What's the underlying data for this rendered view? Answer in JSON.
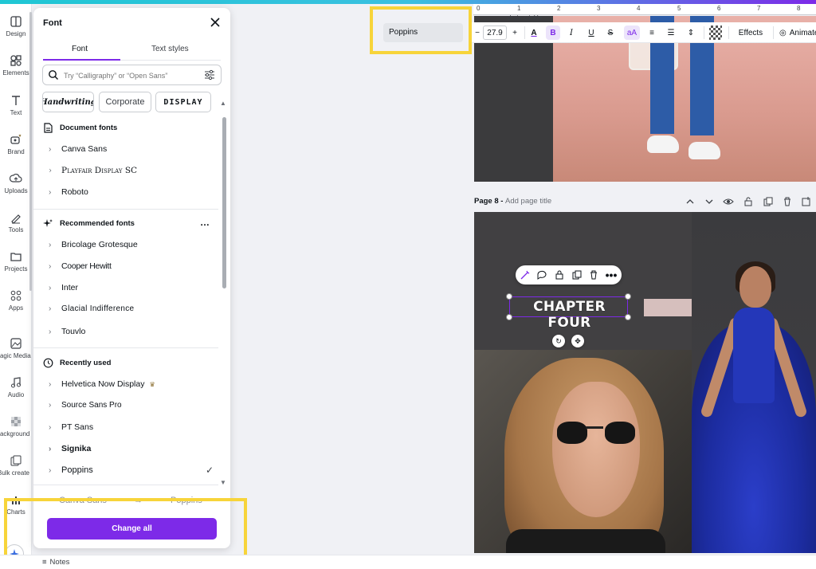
{
  "rail": {
    "items": [
      {
        "label": "Design",
        "icon": "design-icon"
      },
      {
        "label": "Elements",
        "icon": "elements-icon"
      },
      {
        "label": "Text",
        "icon": "text-icon"
      },
      {
        "label": "Brand",
        "icon": "brand-icon"
      },
      {
        "label": "Uploads",
        "icon": "uploads-icon"
      },
      {
        "label": "Tools",
        "icon": "tools-icon"
      },
      {
        "label": "Projects",
        "icon": "projects-icon"
      },
      {
        "label": "Apps",
        "icon": "apps-icon"
      },
      {
        "label": "Magic Media",
        "icon": "magic-media-icon"
      },
      {
        "label": "Audio",
        "icon": "audio-icon"
      },
      {
        "label": "Background",
        "icon": "background-icon"
      },
      {
        "label": "Bulk create",
        "icon": "bulk-create-icon"
      },
      {
        "label": "Charts",
        "icon": "charts-icon"
      }
    ]
  },
  "panel": {
    "title": "Font",
    "tabs": [
      "Font",
      "Text styles"
    ],
    "search_placeholder": "Try “Calligraphy” or “Open Sans”",
    "chips": [
      "Handwriting",
      "Corporate",
      "DISPLAY"
    ],
    "sections": {
      "document": {
        "title": "Document fonts",
        "fonts": [
          "Canva Sans",
          "Playfair Display SC",
          "Roboto"
        ]
      },
      "recommended": {
        "title": "Recommended fonts",
        "more": "…",
        "fonts": [
          "Bricolage Grotesque",
          "Cooper Hewitt",
          "Inter",
          "Glacial Indifference",
          "Touvlo"
        ]
      },
      "recent": {
        "title": "Recently used",
        "fonts": [
          "Helvetica Now Display",
          "Source Sans Pro",
          "PT Sans",
          "Signika",
          "Poppins"
        ]
      }
    },
    "replace_from": "Canva Sans",
    "replace_arrow": "→",
    "replace_to": "Poppins",
    "change_all": "Change all"
  },
  "toolbar": {
    "font_name": "Poppins",
    "minus": "−",
    "font_size": "27.9",
    "plus": "+",
    "effects": "Effects",
    "animate": "Animate"
  },
  "ruler": {
    "numbers": [
      "0",
      "1",
      "2",
      "3",
      "4",
      "5",
      "6",
      "7",
      "8"
    ],
    "tag": "drain crinkle"
  },
  "page8": {
    "label": "Page 8 -",
    "placeholder": "Add page title",
    "heading": "CHAPTER FOUR"
  },
  "bottom": {
    "notes": "Notes"
  },
  "colors": {
    "accent": "#7d2ae8",
    "highlight": "#f7d43a"
  }
}
